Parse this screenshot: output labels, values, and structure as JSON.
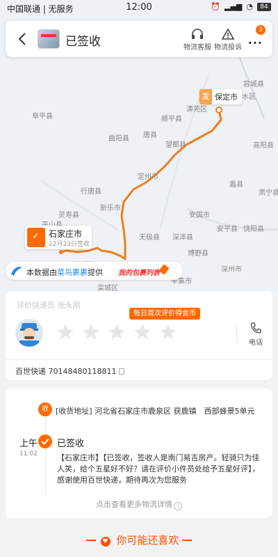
{
  "status_bar": {
    "carrier": "中国联通 | 无服务",
    "time": "12:00",
    "battery": "84"
  },
  "header": {
    "title": "已签收",
    "service_label": "物流客服",
    "complaint_label": "物流投诉",
    "more_badge": "3"
  },
  "map": {
    "labels": [
      {
        "name": "阜平县"
      },
      {
        "name": "顺平县"
      },
      {
        "name": "曲阳县"
      },
      {
        "name": "唐县"
      },
      {
        "name": "望都县"
      },
      {
        "name": "定州市"
      },
      {
        "name": "行唐县"
      },
      {
        "name": "新乐市"
      },
      {
        "name": "灵寿县"
      },
      {
        "name": "平山县"
      },
      {
        "name": "无极县"
      },
      {
        "name": "深泽县"
      },
      {
        "name": "安国市"
      },
      {
        "name": "蠡县"
      },
      {
        "name": "高阳县"
      },
      {
        "name": "容城县"
      },
      {
        "name": "徐水区"
      },
      {
        "name": "博野县"
      },
      {
        "name": "安平县"
      },
      {
        "name": "饶阳县"
      },
      {
        "name": "深州市"
      },
      {
        "name": "肃宁县"
      },
      {
        "name": "清苑区"
      },
      {
        "name": "藁城区"
      },
      {
        "name": "辛集市"
      },
      {
        "name": "栾城区"
      }
    ],
    "destination": {
      "badge": "发",
      "name": "保定市"
    },
    "origin": {
      "name": "石家庄市",
      "date": "12月23日签收"
    }
  },
  "provider": {
    "prefix": "本数据由",
    "source": "菜鸟裹裹",
    "suffix": "提供",
    "slogan": "我的包裹列表"
  },
  "courier": {
    "label": "评价快递员 张永刚",
    "promo": "每日首次评价得金币",
    "phone_label": "电话",
    "tracking": "百世快递 70148480118811"
  },
  "timeline": {
    "receive_badge": "收",
    "receive_address": "[收货地址] 河北省石家庄市鹿泉区 获鹿镇　西部蜂景5单元",
    "period": "上午",
    "time": "11:02",
    "sign_title": "已签收",
    "sign_detail": "【石家庄市】【已签收，签收人是南门易吉房产。轻骑只为佳人笑，给个五星好不好？请在评价小件员处给予五星好评】，感谢使用百世快递，期待再次为您服务",
    "see_more": "点击查看更多物流详情"
  },
  "recommend": {
    "title": "你可能还喜欢"
  },
  "colors": {
    "accent": "#ff6a00",
    "route": "#f07d1b",
    "link": "#1e86e8"
  }
}
